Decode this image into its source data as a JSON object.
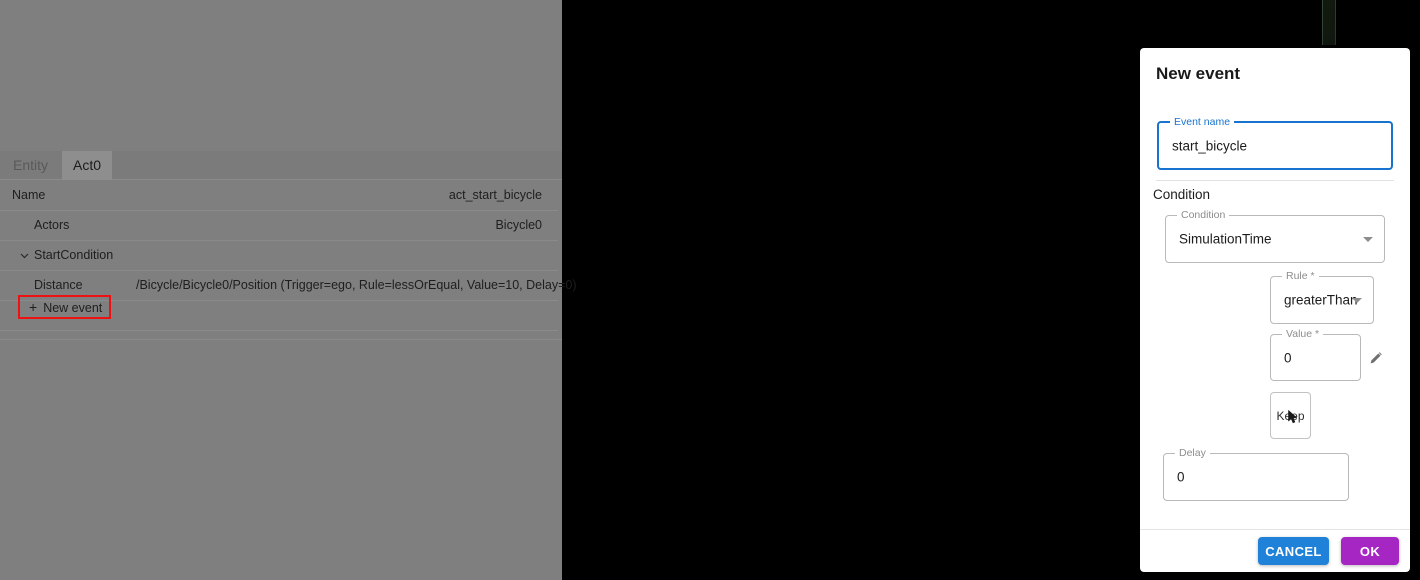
{
  "viewport": {
    "name": "scenario-3d-viewport"
  },
  "left_panel": {
    "tabs": [
      {
        "label": "Entity",
        "active": false
      },
      {
        "label": "Act0",
        "active": true
      }
    ],
    "rows": [
      {
        "label": "Name",
        "value": "act_start_bicycle",
        "align": "right",
        "indent": false,
        "chevron": false
      },
      {
        "label": "Actors",
        "value": "Bicycle0",
        "align": "right",
        "indent": true,
        "chevron": false
      },
      {
        "label": "StartCondition",
        "value": "",
        "align": "right",
        "indent": true,
        "chevron": true
      },
      {
        "label": "Distance",
        "value": "/Bicycle/Bicycle0/Position (Trigger=ego, Rule=lessOrEqual, Value=10, Delay=0)",
        "align": "left",
        "indent": true,
        "chevron": false
      }
    ],
    "new_event_button": {
      "label": "New event",
      "plus": "+",
      "highlight_color": "#ee1111"
    }
  },
  "dialog": {
    "title": "New event",
    "event_name": {
      "label": "Event name",
      "value": "start_bicycle",
      "focused": true
    },
    "condition_section": {
      "heading": "Condition",
      "condition": {
        "label": "Condition",
        "value": "SimulationTime"
      },
      "rule": {
        "label": "Rule *",
        "value": "greaterThan"
      },
      "value": {
        "label": "Value *",
        "value": "0"
      },
      "keep": {
        "label": "Keep"
      },
      "delay": {
        "label": "Delay",
        "value": "0"
      }
    },
    "actions": {
      "cancel": {
        "label": "CANCEL",
        "color": "#1f82d8"
      },
      "ok": {
        "label": "OK",
        "color": "#a626c4"
      }
    }
  }
}
